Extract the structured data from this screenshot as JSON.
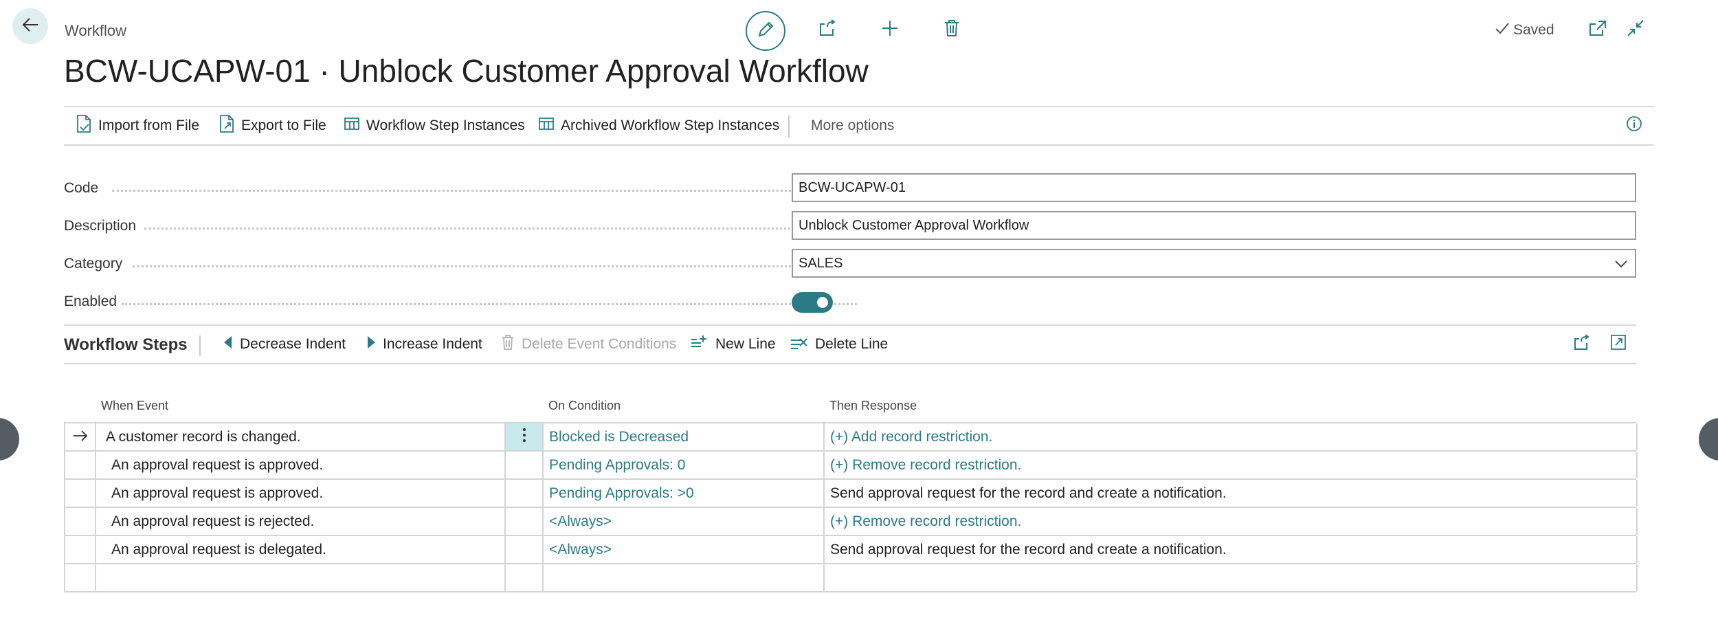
{
  "header": {
    "breadcrumb": "Workflow",
    "title": "BCW-UCAPW-01 · Unblock Customer Approval Workflow",
    "saved_label": "Saved"
  },
  "actions": {
    "import_label": "Import from File",
    "export_label": "Export to File",
    "step_instances_label": "Workflow Step Instances",
    "archived_label": "Archived Workflow Step Instances",
    "more_label": "More options"
  },
  "fields": {
    "code_label": "Code",
    "code_value": "BCW-UCAPW-01",
    "description_label": "Description",
    "description_value": "Unblock Customer Approval Workflow",
    "category_label": "Category",
    "category_value": "SALES",
    "enabled_label": "Enabled",
    "enabled_value": true
  },
  "steps": {
    "title": "Workflow Steps",
    "decrease_label": "Decrease Indent",
    "increase_label": "Increase Indent",
    "delete_cond_label": "Delete Event Conditions",
    "new_line_label": "New Line",
    "delete_line_label": "Delete Line",
    "columns": {
      "event": "When Event",
      "condition": "On Condition",
      "response": "Then Response"
    },
    "rows": [
      {
        "event": "A customer record is changed.",
        "condition": "Blocked is Decreased",
        "response": "(+) Add record restriction."
      },
      {
        "event": "An approval request is approved.",
        "condition": "Pending Approvals: 0",
        "response": "(+) Remove record restriction."
      },
      {
        "event": "An approval request is approved.",
        "condition": "Pending Approvals: >0",
        "response": "Send approval request for the record and create a notification."
      },
      {
        "event": "An approval request is rejected.",
        "condition": "<Always>",
        "response": "(+) Remove record restriction."
      },
      {
        "event": "An approval request is delegated.",
        "condition": "<Always>",
        "response": "Send approval request for the record and create a notification."
      }
    ]
  },
  "colors": {
    "accent": "#2a7b85",
    "back_button_bg": "#dfeff0",
    "selected_cell": "#c8eaec"
  },
  "icons": [
    "arrow-left-icon",
    "pencil-icon",
    "share-icon",
    "plus-icon",
    "trash-icon",
    "checkmark-icon",
    "open-new-window-icon",
    "collapse-icon",
    "import-file-icon",
    "export-file-icon",
    "table-icon",
    "info-icon",
    "chevron-down-icon",
    "triangle-left-icon",
    "triangle-right-icon",
    "new-line-icon",
    "delete-line-icon",
    "expand-icon",
    "row-arrow-icon",
    "kebab-icon"
  ]
}
